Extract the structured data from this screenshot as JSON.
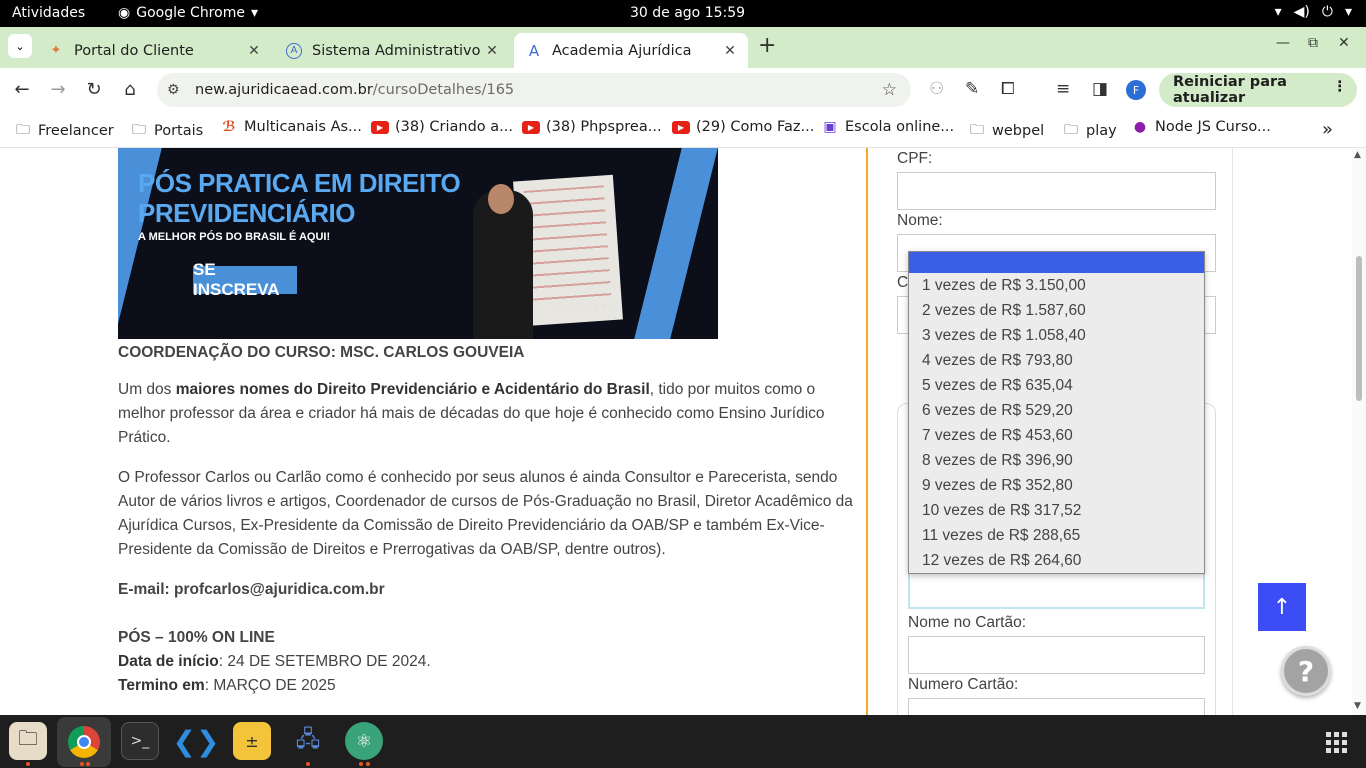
{
  "topbar": {
    "activities": "Atividades",
    "app_name": "Google Chrome",
    "clock": "30 de ago  15:59"
  },
  "tabs": [
    {
      "title": "Portal do Cliente",
      "icon": "puzzle-favicon"
    },
    {
      "title": "Sistema Administrativo",
      "icon": "a-favicon"
    },
    {
      "title": "Academia Ajurídica",
      "icon": "a-favicon",
      "active": true
    }
  ],
  "toolbar": {
    "url_host": "new.ajuridicaead.com.br",
    "url_path": "/cursoDetalhes/165",
    "profile_initial": "F",
    "update_label": "Reiniciar para atualizar"
  },
  "bookmarks": [
    {
      "label": "Freelancer",
      "icon": "folder-icon"
    },
    {
      "label": "Portais",
      "icon": "folder-icon"
    },
    {
      "label": "Multicanais As...",
      "icon": "multicanais-icon"
    },
    {
      "label": "(38) Criando a...",
      "icon": "youtube-icon"
    },
    {
      "label": "(38) Phpsprea...",
      "icon": "youtube-icon"
    },
    {
      "label": "(29) Como Faz...",
      "icon": "youtube-icon"
    },
    {
      "label": "Escola online...",
      "icon": "escola-icon"
    },
    {
      "label": "webpel",
      "icon": "folder-icon"
    },
    {
      "label": "play",
      "icon": "folder-icon"
    },
    {
      "label": "Node JS Curso...",
      "icon": "node-icon"
    }
  ],
  "banner": {
    "headline_1": "PÓS PRATICA EM DIREITO",
    "headline_2": "PREVIDENCIÁRIO",
    "subline": "A MELHOR PÓS DO BRASIL É AQUI!",
    "cta": "SE INSCREVA"
  },
  "course": {
    "coordination": "COORDENAÇÃO DO CURSO: MSC. CARLOS GOUVEIA",
    "p1_pre": "Um dos ",
    "p1_bold": "maiores nomes do Direito Previdenciário e Acidentário do Brasil",
    "p1_post": ", tido por muitos como o melhor professor da área e criador há mais de décadas do que hoje é conhecido como Ensino Jurídico Prático.",
    "p2": "O Professor Carlos ou Carlão como é conhecido por seus alunos é ainda Consultor e Parecerista, sendo Autor de vários livros e artigos, Coordenador de cursos de Pós-Graduação no Brasil, Diretor Acadêmico da Ajurídica Cursos, Ex-Presidente da Comissão de Direito Previdenciário da OAB/SP e também Ex-Vice-Presidente da Comissão de Direitos e Prerrogativas da OAB/SP, dentre outros).",
    "email": "E-mail: profcarlos@ajuridica.com.br",
    "modality": "PÓS – 100% ON LINE",
    "start_label": "Data de início",
    "start_value": ": 24 DE SETEMBRO DE 2024.",
    "end_label": "Termino em",
    "end_value": ": MARÇO DE 2025"
  },
  "form": {
    "cpf_label": "CPF:",
    "name_label": "Nome:",
    "c_label_partial": "C",
    "card_name_label": "Nome no Cartão:",
    "card_number_label": "Numero Cartão:"
  },
  "installments": {
    "selected": "",
    "options": [
      "1 vezes de R$ 3.150,00",
      "2 vezes de R$ 1.587,60",
      "3 vezes de R$ 1.058,40",
      "4 vezes de R$ 793,80",
      "5 vezes de R$ 635,04",
      "6 vezes de R$ 529,20",
      "7 vezes de R$ 453,60",
      "8 vezes de R$ 396,90",
      "9 vezes de R$ 352,80",
      "10 vezes de R$ 317,52",
      "11 vezes de R$ 288,65",
      "12 vezes de R$ 264,60"
    ]
  },
  "widgets": {
    "scroll_top_glyph": "↑",
    "help_glyph": "?"
  },
  "colors": {
    "accent_blue": "#3d4df5",
    "dropdown_selected": "#3b5ee6",
    "divider_orange": "#f5a623",
    "chrome_green": "#d3ebc8"
  }
}
